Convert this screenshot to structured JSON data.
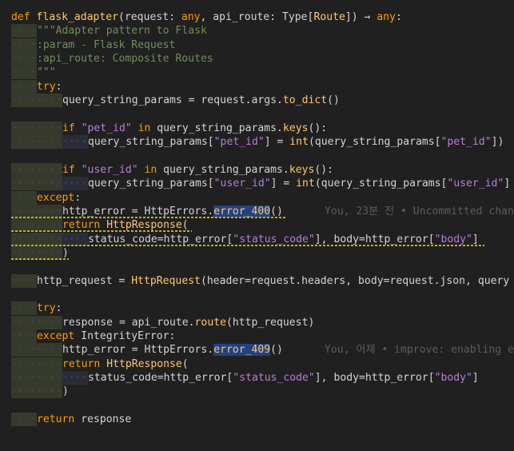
{
  "lines": [
    {
      "ind": 0,
      "segs": [
        [
          "kw",
          "def "
        ],
        [
          "fn",
          "flask_adapter"
        ],
        [
          "pl",
          "(request: "
        ],
        [
          "kw",
          "any"
        ],
        [
          "pl",
          ", api_route: Type["
        ],
        [
          "ty",
          "Route"
        ],
        [
          "pl",
          "]) → "
        ],
        [
          "kw",
          "any"
        ],
        [
          "pl",
          ":"
        ]
      ]
    },
    {
      "ind": 1,
      "segs": [
        [
          "doc",
          "\"\"\"Adapter pattern to Flask"
        ]
      ]
    },
    {
      "ind": 1,
      "segs": [
        [
          "doc",
          ":param - Flask Request"
        ]
      ]
    },
    {
      "ind": 1,
      "segs": [
        [
          "doc",
          ":api_route: Composite Routes"
        ]
      ]
    },
    {
      "ind": 1,
      "segs": [
        [
          "doc",
          "\"\"\""
        ]
      ]
    },
    {
      "ind": 1,
      "segs": [
        [
          "kw",
          "try"
        ],
        [
          "pl",
          ":"
        ]
      ]
    },
    {
      "ind": 2,
      "segs": [
        [
          "pl",
          "query_string_params = request.args."
        ],
        [
          "fn",
          "to_dict"
        ],
        [
          "pl",
          "()"
        ]
      ]
    },
    {
      "ind": 0,
      "segs": []
    },
    {
      "ind": 2,
      "segs": [
        [
          "kw",
          "if "
        ],
        [
          "str",
          "\"pet_id\""
        ],
        [
          "kw",
          " in "
        ],
        [
          "pl",
          "query_string_params."
        ],
        [
          "fn",
          "keys"
        ],
        [
          "pl",
          "():"
        ]
      ]
    },
    {
      "ind": 3,
      "segs": [
        [
          "pl",
          "query_string_params["
        ],
        [
          "str",
          "\"pet_id\""
        ],
        [
          "pl",
          "] = "
        ],
        [
          "fn",
          "int"
        ],
        [
          "pl",
          "(query_string_params["
        ],
        [
          "str",
          "\"pet_id\""
        ],
        [
          "pl",
          "])"
        ]
      ]
    },
    {
      "ind": 0,
      "segs": []
    },
    {
      "ind": 2,
      "segs": [
        [
          "kw",
          "if "
        ],
        [
          "str",
          "\"user_id\""
        ],
        [
          "kw",
          " in "
        ],
        [
          "pl",
          "query_string_params."
        ],
        [
          "fn",
          "keys"
        ],
        [
          "pl",
          "():"
        ]
      ]
    },
    {
      "ind": 3,
      "segs": [
        [
          "pl",
          "query_string_params["
        ],
        [
          "str",
          "\"user_id\""
        ],
        [
          "pl",
          "] = "
        ],
        [
          "fn",
          "int"
        ],
        [
          "pl",
          "(query_string_params["
        ],
        [
          "str",
          "\"user_id\""
        ],
        [
          "pl",
          "]"
        ]
      ]
    },
    {
      "ind": 1,
      "segs": [
        [
          "kw",
          "except"
        ],
        [
          "pl",
          ":"
        ]
      ]
    },
    {
      "ind": 2,
      "segs": [
        [
          "pl",
          "http_error = HttpErrors."
        ],
        [
          "fnhl",
          "error_400"
        ],
        [
          "pl",
          "()"
        ]
      ],
      "annotation": "You, 23분 전 • Uncommitted chan"
    },
    {
      "ind": 2,
      "segs": [
        [
          "kw",
          "return "
        ],
        [
          "fn",
          "HttpResponse"
        ],
        [
          "pl",
          "("
        ]
      ]
    },
    {
      "ind": 3,
      "segs": [
        [
          "pl",
          "status_code=http_error["
        ],
        [
          "str",
          "\"status_code\""
        ],
        [
          "pl",
          "], body=http_error["
        ],
        [
          "str",
          "\"body\""
        ],
        [
          "pl",
          "]"
        ]
      ]
    },
    {
      "ind": 2,
      "segs": [
        [
          "pl",
          ")"
        ]
      ]
    },
    {
      "ind": 0,
      "segs": []
    },
    {
      "ind": 1,
      "segs": [
        [
          "pl",
          "http_request = "
        ],
        [
          "fn",
          "HttpRequest"
        ],
        [
          "pl",
          "(header=request.headers, body=request.json, query"
        ]
      ]
    },
    {
      "ind": 0,
      "segs": []
    },
    {
      "ind": 1,
      "segs": [
        [
          "kw",
          "try"
        ],
        [
          "pl",
          ":"
        ]
      ]
    },
    {
      "ind": 2,
      "segs": [
        [
          "pl",
          "response = api_route."
        ],
        [
          "fn",
          "route"
        ],
        [
          "pl",
          "(http_request)"
        ]
      ]
    },
    {
      "ind": 1,
      "segs": [
        [
          "kw",
          "except "
        ],
        [
          "pl",
          "IntegrityError:"
        ]
      ]
    },
    {
      "ind": 2,
      "segs": [
        [
          "pl",
          "http_error = HttpErrors."
        ],
        [
          "fnhl",
          "error_409"
        ],
        [
          "pl",
          "()"
        ]
      ],
      "annotation": "You, 어제 • improve: enabling e"
    },
    {
      "ind": 2,
      "segs": [
        [
          "kw",
          "return "
        ],
        [
          "fn",
          "HttpResponse"
        ],
        [
          "pl",
          "("
        ]
      ]
    },
    {
      "ind": 3,
      "segs": [
        [
          "pl",
          "status_code=http_error["
        ],
        [
          "str",
          "\"status_code\""
        ],
        [
          "pl",
          "], body=http_error["
        ],
        [
          "str",
          "\"body\""
        ],
        [
          "pl",
          "]"
        ]
      ]
    },
    {
      "ind": 2,
      "segs": [
        [
          "pl",
          ")"
        ]
      ]
    },
    {
      "ind": 0,
      "segs": []
    },
    {
      "ind": 1,
      "segs": [
        [
          "kw",
          "return "
        ],
        [
          "pl",
          "response"
        ]
      ]
    }
  ]
}
